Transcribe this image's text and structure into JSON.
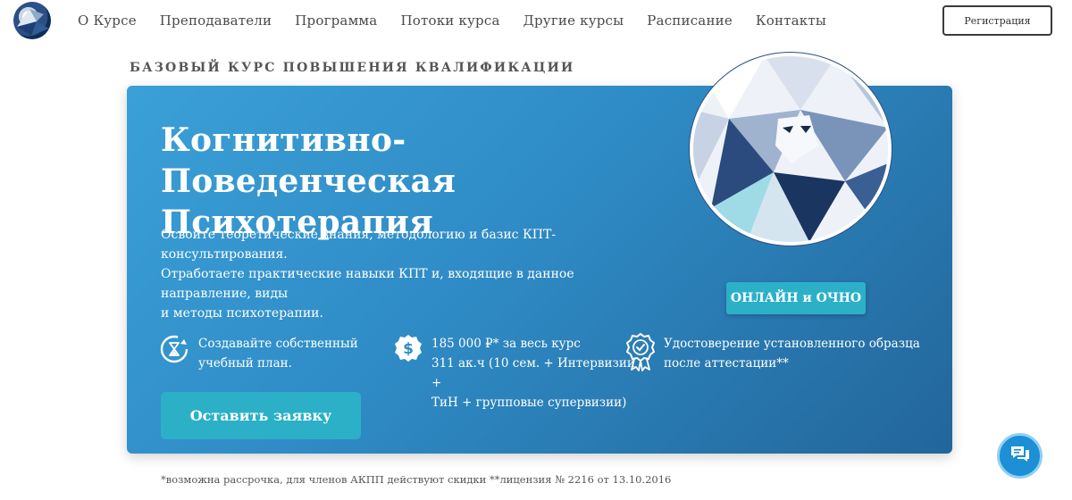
{
  "header": {
    "nav": [
      "О Курсе",
      "Преподаватели",
      "Программа",
      "Потоки курса",
      "Другие курсы",
      "Расписание",
      "Контакты"
    ],
    "register_label": "Регистрация"
  },
  "hero": {
    "kicker": "БАЗОВЫЙ КУРС ПОВЫШЕНИЯ КВАЛИФИКАЦИИ",
    "title_line1": "Когнитивно-Поведенческая",
    "title_line2": "Психотерапия",
    "lead_line1": "Освоите теоретические знания, методологию и базис КПТ-консультирования.",
    "lead_line2": "Отработаете практические навыки КПТ и, входящие в данное направление, виды",
    "lead_line3": "и методы психотерапии.",
    "format_label": "ОНЛАЙН и ОЧНО",
    "features": {
      "plan_line1": "Создавайте собственный",
      "plan_line2": "учебный план.",
      "price_line1": "185 000 ₽* за весь курс",
      "price_line2": "311 ак.ч (10 сем. + Интервизии +",
      "price_line3": "ТиН + групповые супервизии)",
      "cert_line1": "Удостоверение установленного образца",
      "cert_line2": "после аттестации**"
    },
    "apply_label": "Оставить заявку",
    "footnote": "*возможна рассрочка, для членов АКПП действуют скидки **лицензия № 2216 от 13.10.2016"
  },
  "icons": {
    "logo": "logo-icon",
    "plan": "hourglass-refresh-icon",
    "price": "dollar-badge-icon",
    "cert": "award-ribbon-icon",
    "chat": "chat-bubble-icon"
  },
  "colors": {
    "card_light": "#3ba0d8",
    "card_dark": "#22669b",
    "accent_button": "#2bb0c8",
    "chat_button": "#1c8fd6"
  }
}
